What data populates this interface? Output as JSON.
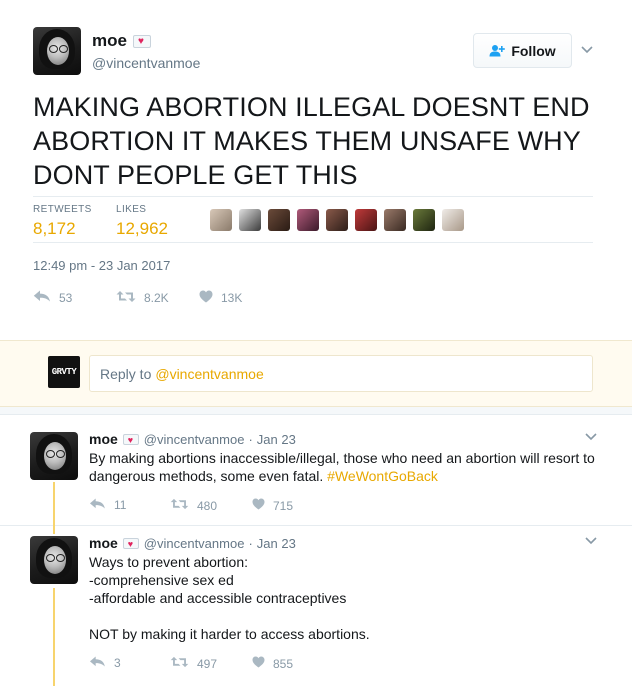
{
  "main_tweet": {
    "display_name": "moe",
    "handle": "@vincentvanmoe",
    "follow_label": "Follow",
    "text": "MAKING ABORTION ILLEGAL DOESNT END ABORTION IT MAKES THEM UNSAFE WHY DONT PEOPLE GET THIS",
    "stats": {
      "retweets_label": "RETWEETS",
      "retweets_value": "8,172",
      "likes_label": "LIKES",
      "likes_value": "12,962"
    },
    "timestamp": "12:49 pm - 23 Jan 2017",
    "actions": {
      "reply_count": "53",
      "retweet_count": "8.2K",
      "like_count": "13K"
    }
  },
  "reply_box": {
    "logo_text": "GRVTY",
    "prompt": "Reply to",
    "mention": "@vincentvanmoe"
  },
  "replies": [
    {
      "display_name": "moe",
      "handle": "@vincentvanmoe",
      "separator": "·",
      "date": "Jan 23",
      "text": "By making abortions inaccessible/illegal, those who need an abortion will resort to dangerous methods, some even fatal.",
      "hashtag": "#WeWontGoBack",
      "reply_count": "11",
      "retweet_count": "480",
      "like_count": "715"
    },
    {
      "display_name": "moe",
      "handle": "@vincentvanmoe",
      "separator": "·",
      "date": "Jan 23",
      "text": "Ways to prevent abortion:\n-comprehensive sex ed\n-affordable and accessible contraceptives\n\nNOT by making it harder to access abortions.",
      "reply_count": "3",
      "retweet_count": "497",
      "like_count": "855"
    }
  ],
  "colors": {
    "accent": "#e8a800",
    "action_gray": "#8899a6",
    "heart": "#e0245e",
    "thread_line": "#f7d46d"
  },
  "icons": {
    "follow": "user-plus-icon",
    "caret": "chevron-down-icon",
    "reply": "reply-icon",
    "retweet": "retweet-icon",
    "like": "heart-icon",
    "name_badge": "love-letter-icon"
  }
}
